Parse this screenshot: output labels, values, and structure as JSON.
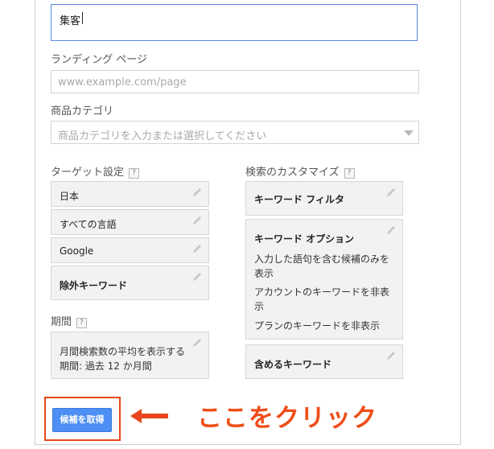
{
  "keyword_field": {
    "value": "集客"
  },
  "landing_page": {
    "label": "ランディング ページ",
    "placeholder": "www.example.com/page"
  },
  "category": {
    "label": "商品カテゴリ",
    "placeholder": "商品カテゴリを入力または選択してください"
  },
  "targeting": {
    "heading": "ターゲット設定",
    "help": "?",
    "items": [
      {
        "text": "日本"
      },
      {
        "text": "すべての言語"
      },
      {
        "text": "Google"
      },
      {
        "text": "除外キーワード"
      }
    ]
  },
  "period": {
    "heading": "期間",
    "help": "?",
    "line1": "月間検索数の平均を表示する",
    "line2": "期間: 過去 12 か月間"
  },
  "customize": {
    "heading": "検索のカスタマイズ",
    "help": "?",
    "filter_label": "キーワード フィルタ",
    "options_title": "キーワード オプション",
    "options_lines": [
      "入力した語句を含む候補のみを",
      "表示",
      "アカウントのキーワードを非表",
      "示",
      "プランのキーワードを非表示"
    ],
    "include_label": "含めるキーワード"
  },
  "get_ideas_button": {
    "label": "候補を取得"
  },
  "annotation": {
    "text": "ここをクリック"
  },
  "colors": {
    "accent_blue": "#4d8ff4",
    "highlight_red": "#e8451c",
    "callout_orange": "#ee4f1a"
  },
  "icons": {
    "edit": "pencil-icon",
    "dropdown": "chevron-down-icon",
    "help": "help-icon",
    "pointer": "arrow-left-icon"
  }
}
